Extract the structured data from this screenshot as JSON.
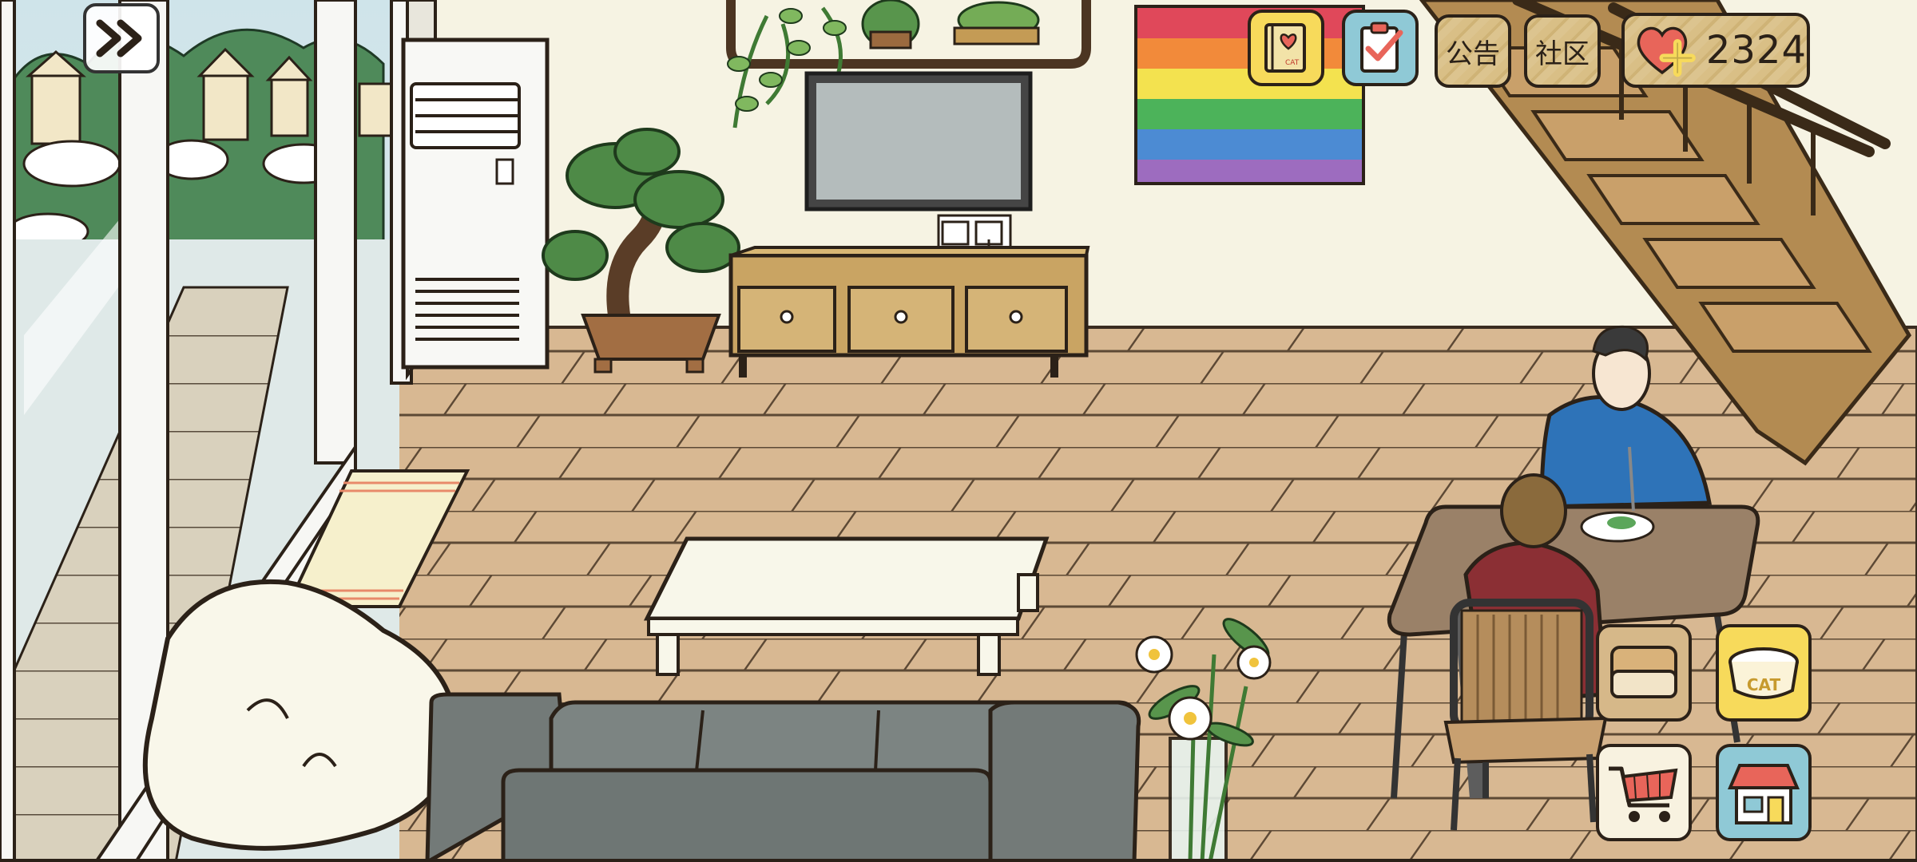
{
  "hud": {
    "notice_label": "公告",
    "community_label": "社区",
    "hearts": "2324",
    "cat_bowl_label": "CAT",
    "diary_label": "CAT"
  },
  "icons": {
    "skip": "double-chevron-right-icon",
    "diary": "cat-diary-book-icon",
    "tasks": "clipboard-check-icon",
    "heart_plus": "heart-plus-icon",
    "food_box": "food-box-icon",
    "cat_bowl": "cat-bowl-icon",
    "shop_cart": "shopping-cart-icon",
    "home_store": "store-house-icon"
  },
  "colors": {
    "wall": "#f6f3e3",
    "floor": "#d8b892",
    "accent_yellow": "#f7da5b",
    "accent_blue": "#8fc9d6",
    "heart": "#e8655a"
  }
}
